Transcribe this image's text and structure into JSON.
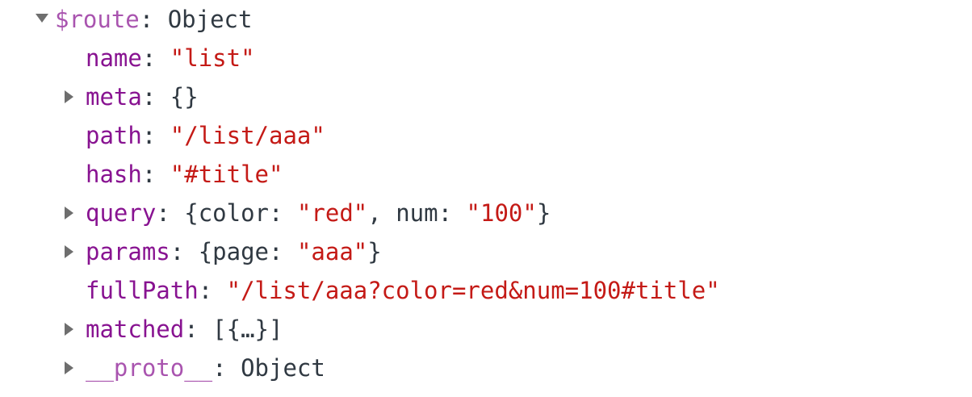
{
  "root": {
    "key": "$route",
    "sep": ":",
    "value": "Object",
    "icon": "triangle-down-icon"
  },
  "props": [
    {
      "key": "name",
      "sep": ":",
      "value": "\"list\"",
      "value_type": "string",
      "expandable": false
    },
    {
      "key": "meta",
      "sep": ":",
      "value": "{}",
      "value_type": "object",
      "expandable": true
    },
    {
      "key": "path",
      "sep": ":",
      "value": "\"/list/aaa\"",
      "value_type": "string",
      "expandable": false
    },
    {
      "key": "hash",
      "sep": ":",
      "value": "\"#title\"",
      "value_type": "string",
      "expandable": false
    },
    {
      "key": "query",
      "sep": ":",
      "expandable": true,
      "value_type": "preview",
      "preview": {
        "open": "{",
        "k1": "color",
        "c1": ":",
        "v1": "\"red\"",
        "comma": ",",
        "k2": "num",
        "c2": ":",
        "v2": "\"100\"",
        "close": "}"
      }
    },
    {
      "key": "params",
      "sep": ":",
      "expandable": true,
      "value_type": "preview",
      "preview": {
        "open": "{",
        "k1": "page",
        "c1": ":",
        "v1": "\"aaa\"",
        "close": "}"
      }
    },
    {
      "key": "fullPath",
      "sep": ":",
      "value": "\"/list/aaa?color=red&num=100#title\"",
      "value_type": "string",
      "expandable": false
    },
    {
      "key": "matched",
      "sep": ":",
      "value": "[{…}]",
      "value_type": "object",
      "expandable": true
    },
    {
      "key": "__proto__",
      "sep": ":",
      "value": "Object",
      "value_type": "object",
      "expandable": true
    }
  ],
  "colors": {
    "key": "#881391",
    "string": "#c41a16",
    "text": "#303942",
    "triangle": "#6e6e6e"
  }
}
